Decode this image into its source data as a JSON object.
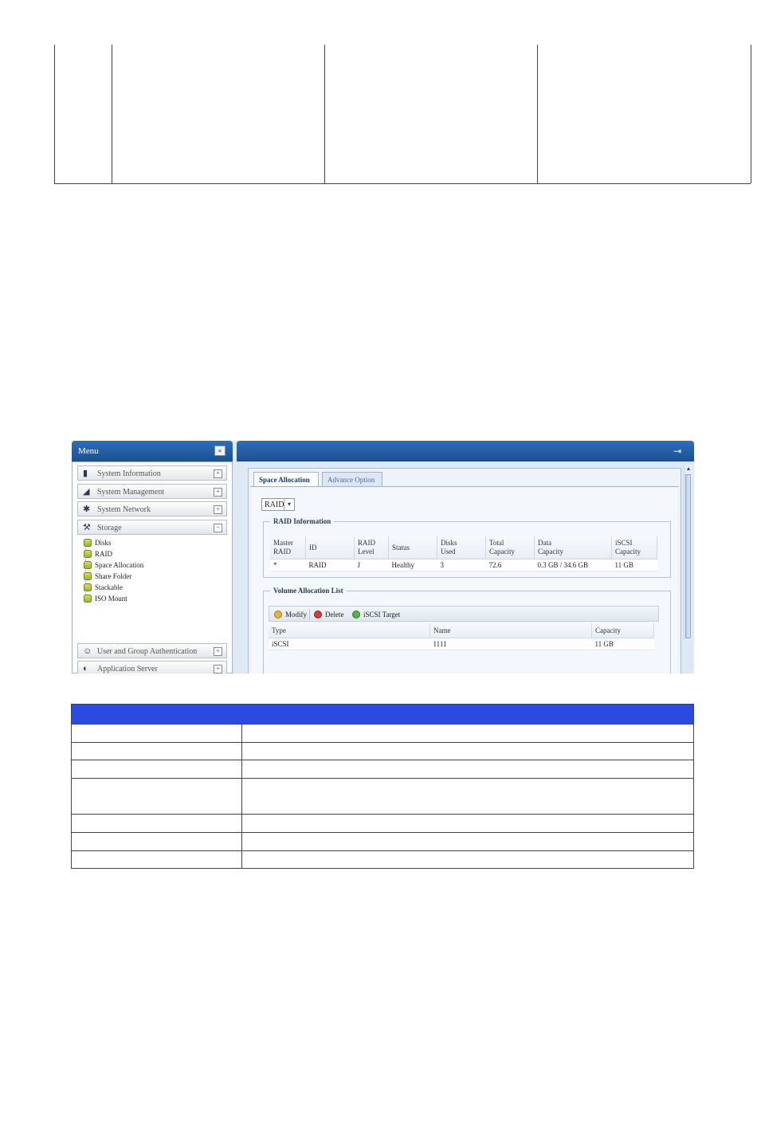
{
  "sidebar": {
    "title": "Menu",
    "collapse_glyph": "«",
    "sections": [
      {
        "label": "System Information",
        "toggle": "+"
      },
      {
        "label": "System Management",
        "toggle": "+"
      },
      {
        "label": "System Network",
        "toggle": "+"
      },
      {
        "label": "Storage",
        "toggle": "−"
      },
      {
        "label": "User and Group Authentication",
        "toggle": "+"
      },
      {
        "label": "Application Server",
        "toggle": "+"
      }
    ],
    "storage_items": [
      "Disks",
      "RAID",
      "Space Allocation",
      "Share Folder",
      "Stackable",
      "ISO Mount"
    ]
  },
  "tabs": [
    {
      "label": "Space Allocation",
      "active": true
    },
    {
      "label": "Advance Option",
      "active": false
    }
  ],
  "raid_select": {
    "value": "RAID"
  },
  "raid_info": {
    "legend": "RAID Information",
    "columns": [
      [
        "Master",
        "RAID"
      ],
      [
        "ID",
        ""
      ],
      [
        "RAID",
        "Level"
      ],
      [
        "Status",
        ""
      ],
      [
        "Disks",
        "Used"
      ],
      [
        "Total",
        "Capacity"
      ],
      [
        "Data",
        "Capacity"
      ],
      [
        "iSCSI",
        "Capacity"
      ]
    ],
    "rows": [
      [
        "*",
        "RAID",
        "J",
        "Healthy",
        "3",
        "72.6",
        "0.3 GB / 34.6 GB",
        "11 GB"
      ]
    ]
  },
  "volume_list": {
    "legend": "Volume Allocation List",
    "toolbar": {
      "modify": "Modify",
      "delete": "Delete",
      "iscsi_target": "iSCSI Target"
    },
    "columns": [
      "Type",
      "Name",
      "Capacity"
    ],
    "rows": [
      [
        "iSCSI",
        "1111",
        "11 GB"
      ]
    ]
  },
  "colors": {
    "header_blue": "#2b4be0",
    "panel_blue": "#1b4f92"
  }
}
